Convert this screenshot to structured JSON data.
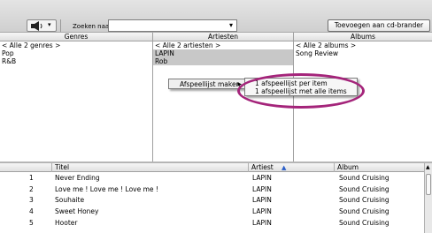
{
  "toolbar": {
    "speaker_icon": "speaker-icon",
    "search_label": "Zoeken naar:",
    "search_value": "",
    "add_cd_button": "Toevoegen aan cd-brander"
  },
  "browser": {
    "columns": [
      {
        "header": "Genres",
        "items": [
          "< Alle 2 genres >",
          "Pop",
          "R&B"
        ]
      },
      {
        "header": "Artiesten",
        "items": [
          "< Alle 2 artiesten >",
          "LAPIN",
          "Rob"
        ]
      },
      {
        "header": "Albums",
        "items": [
          "< Alle 2 albums >",
          "Song Review"
        ]
      }
    ]
  },
  "context_menu": {
    "item": "Afspeellijst maken",
    "submenu": [
      "1 afspeellijst per item",
      "1 afspeellijst met alle items"
    ]
  },
  "tracks": {
    "columns": [
      "Titel",
      "Artiest",
      "Album"
    ],
    "sort_indicator": "▲",
    "rows": [
      {
        "num": "1",
        "title": "Never Ending",
        "artist": "LAPIN",
        "album": "Sound Cruising"
      },
      {
        "num": "2",
        "title": "Love me ! Love me ! Love me !",
        "artist": "LAPIN",
        "album": "Sound Cruising"
      },
      {
        "num": "3",
        "title": "Souhaite",
        "artist": "LAPIN",
        "album": "Sound Cruising"
      },
      {
        "num": "4",
        "title": "Sweet Honey",
        "artist": "LAPIN",
        "album": "Sound Cruising"
      },
      {
        "num": "5",
        "title": "Hooter",
        "artist": "LAPIN",
        "album": "Sound Cruising"
      }
    ]
  },
  "colors": {
    "highlight": "#a4247a"
  }
}
